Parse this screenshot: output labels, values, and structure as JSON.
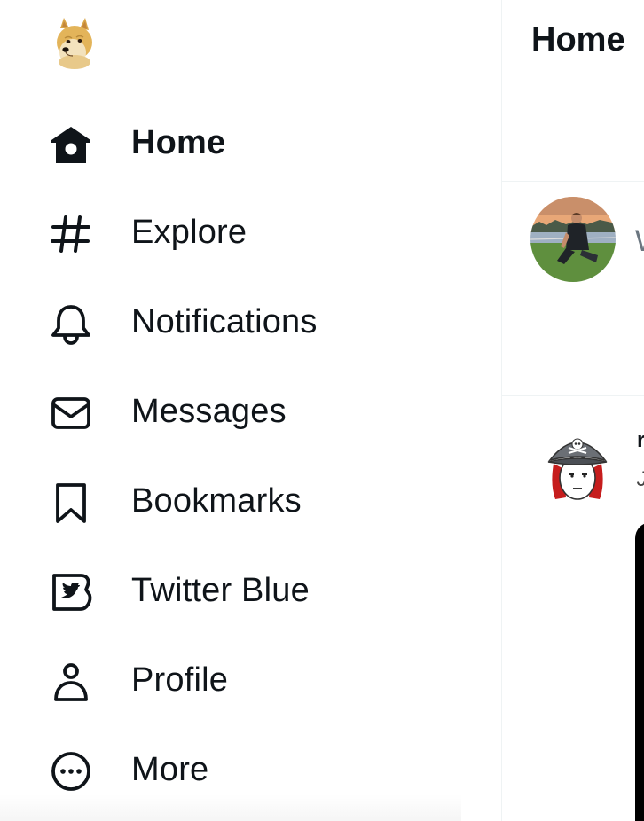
{
  "sidebar": {
    "logo_icon": "doge-logo-icon",
    "items": [
      {
        "label": "Home",
        "icon": "home-icon",
        "active": true
      },
      {
        "label": "Explore",
        "icon": "hashtag-icon",
        "active": false
      },
      {
        "label": "Notifications",
        "icon": "bell-icon",
        "active": false
      },
      {
        "label": "Messages",
        "icon": "envelope-icon",
        "active": false
      },
      {
        "label": "Bookmarks",
        "icon": "bookmark-icon",
        "active": false
      },
      {
        "label": "Twitter Blue",
        "icon": "twitter-blue-icon",
        "active": false
      },
      {
        "label": "Profile",
        "icon": "person-icon",
        "active": false
      },
      {
        "label": "More",
        "icon": "more-circle-icon",
        "active": false
      }
    ]
  },
  "main": {
    "title": "Home",
    "composer": {
      "hint": "W"
    },
    "tweet": {
      "name": "r",
      "text": "J"
    }
  },
  "colors": {
    "text": "#0f1419",
    "divider": "#eff3f4",
    "background": "#ffffff"
  }
}
